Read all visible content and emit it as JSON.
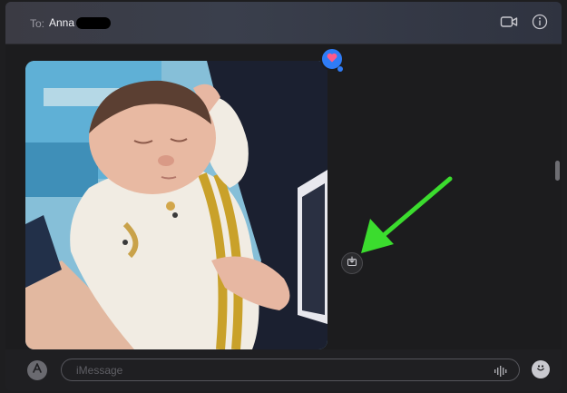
{
  "header": {
    "to_label": "To:",
    "recipient": "Anna"
  },
  "thread": {
    "photo_subject": "newborn-baby-photo",
    "tapback_reaction": "heart",
    "save_icon": "save-to-photos-icon",
    "annotation_arrow_color": "#3bdc2e"
  },
  "composer": {
    "placeholder": "iMessage",
    "apps_icon": "app-store-icon",
    "audio_icon": "audio-waveform-icon",
    "emoji_icon": "emoji-icon"
  },
  "colors": {
    "accent": "#2f7cf6",
    "tapback_heart": "#ff5a8a",
    "arrow": "#3bdc2e"
  }
}
